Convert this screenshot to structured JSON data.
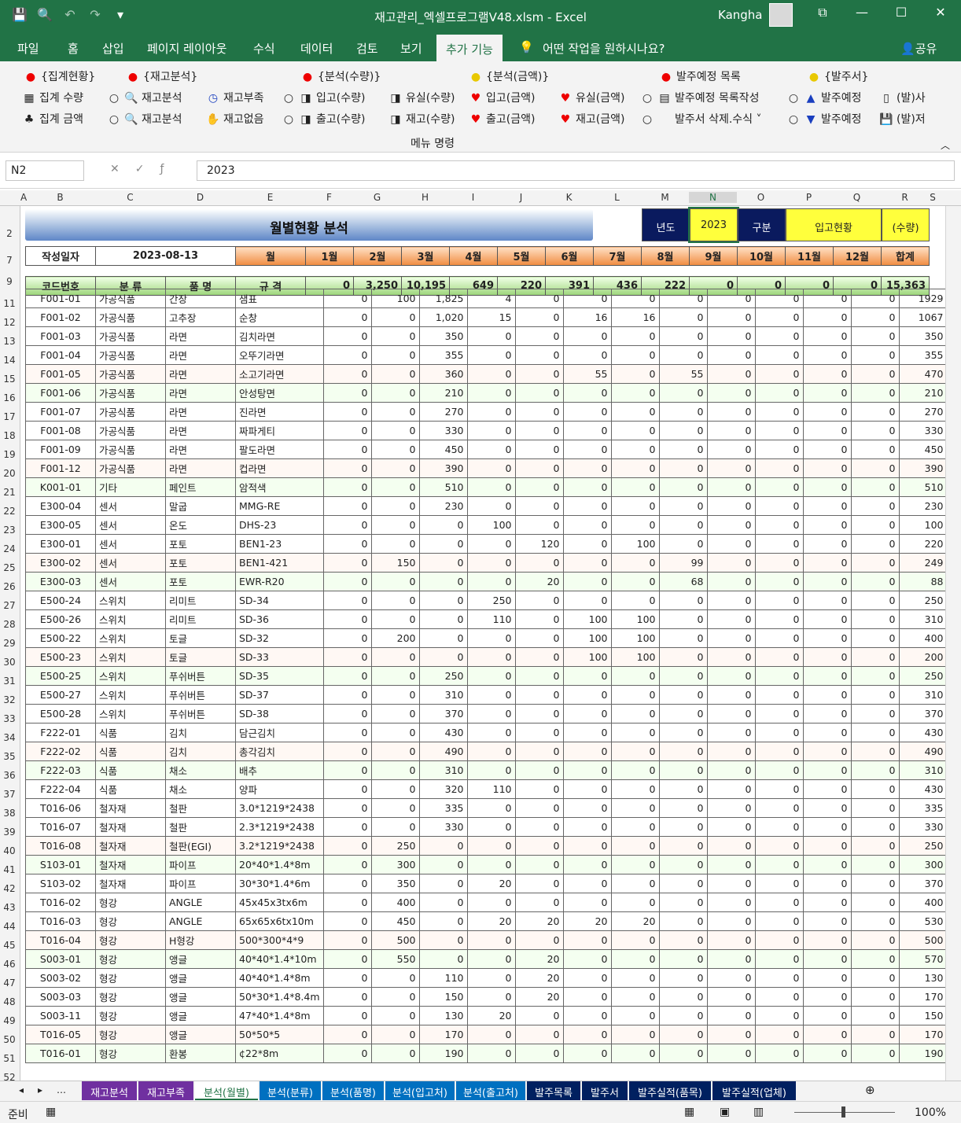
{
  "app": {
    "title": "재고관리_엑셀프로그램V48.xlsm  -  Excel",
    "user": "Kangha"
  },
  "tabs": [
    "파일",
    "홈",
    "삽입",
    "페이지 레이아웃",
    "수식",
    "데이터",
    "검토",
    "보기",
    "추가 기능",
    "어떤 작업을 원하시나요?",
    "공유"
  ],
  "ribbon": {
    "headers": [
      "{집계현황}",
      "{재고분석}",
      "{분석(수량)}",
      "{분석(금액)}",
      "발주예정 목록",
      "{발주서}"
    ],
    "row1": [
      "집계 수량",
      "재고분석",
      "재고부족",
      "입고(수량)",
      "유실(수량)",
      "입고(금액)",
      "유실(금액)",
      "발주예정 목록작성",
      "발주예정",
      "(발)사"
    ],
    "row2": [
      "집계 금액",
      "재고분석",
      "재고없음",
      "출고(수량)",
      "재고(수량)",
      "출고(금액)",
      "재고(금액)",
      "발주서 삭제.수식",
      "발주예정",
      "(발)저"
    ],
    "group": "메뉴 명령"
  },
  "formula": {
    "namebox": "N2",
    "value": "2023"
  },
  "columns": [
    "A",
    "B",
    "C",
    "D",
    "E",
    "F",
    "G",
    "H",
    "I",
    "J",
    "K",
    "L",
    "M",
    "N",
    "O",
    "P",
    "Q",
    "R",
    "S"
  ],
  "rows": [
    "2",
    "7",
    "9",
    "11",
    "12",
    "13",
    "14",
    "15",
    "16",
    "17",
    "18",
    "19",
    "20",
    "21",
    "22",
    "23",
    "24",
    "25",
    "26",
    "27",
    "28",
    "29",
    "30",
    "31",
    "32",
    "33",
    "34",
    "35",
    "36",
    "37",
    "38",
    "39",
    "40",
    "41",
    "42",
    "43",
    "44",
    "45",
    "46",
    "47",
    "48",
    "49",
    "50",
    "51",
    "52"
  ],
  "sheet": {
    "title": "월별현황 분석",
    "year_label": "년도",
    "year": "2023",
    "kind_label": "구분",
    "kind": "입고현황",
    "unit": "(수량)",
    "date_label": "작성일자",
    "date": "2023-08-13",
    "month_header": [
      "월",
      "1월",
      "2월",
      "3월",
      "4월",
      "5월",
      "6월",
      "7월",
      "8월",
      "9월",
      "10월",
      "11월",
      "12월",
      "합계"
    ],
    "col_header": [
      "코드번호",
      "분 류",
      "품 명",
      "규 격"
    ],
    "totals": [
      "0",
      "3,250",
      "10,195",
      "649",
      "220",
      "391",
      "436",
      "222",
      "0",
      "0",
      "0",
      "0",
      "15,363"
    ],
    "data": [
      [
        "F001-01",
        "가공식품",
        "간장",
        "샘표",
        "0",
        "100",
        "1,825",
        "4",
        "0",
        "0",
        "0",
        "0",
        "0",
        "0",
        "0",
        "0",
        "1929"
      ],
      [
        "F001-02",
        "가공식품",
        "고추장",
        "순창",
        "0",
        "0",
        "1,020",
        "15",
        "0",
        "16",
        "16",
        "0",
        "0",
        "0",
        "0",
        "0",
        "1067"
      ],
      [
        "F001-03",
        "가공식품",
        "라면",
        "김치라면",
        "0",
        "0",
        "350",
        "0",
        "0",
        "0",
        "0",
        "0",
        "0",
        "0",
        "0",
        "0",
        "350"
      ],
      [
        "F001-04",
        "가공식품",
        "라면",
        "오뚜기라면",
        "0",
        "0",
        "355",
        "0",
        "0",
        "0",
        "0",
        "0",
        "0",
        "0",
        "0",
        "0",
        "355"
      ],
      [
        "F001-05",
        "가공식품",
        "라면",
        "소고기라면",
        "0",
        "0",
        "360",
        "0",
        "0",
        "55",
        "0",
        "55",
        "0",
        "0",
        "0",
        "0",
        "470"
      ],
      [
        "F001-06",
        "가공식품",
        "라면",
        "안성탕면",
        "0",
        "0",
        "210",
        "0",
        "0",
        "0",
        "0",
        "0",
        "0",
        "0",
        "0",
        "0",
        "210"
      ],
      [
        "F001-07",
        "가공식품",
        "라면",
        "진라면",
        "0",
        "0",
        "270",
        "0",
        "0",
        "0",
        "0",
        "0",
        "0",
        "0",
        "0",
        "0",
        "270"
      ],
      [
        "F001-08",
        "가공식품",
        "라면",
        "짜파게티",
        "0",
        "0",
        "330",
        "0",
        "0",
        "0",
        "0",
        "0",
        "0",
        "0",
        "0",
        "0",
        "330"
      ],
      [
        "F001-09",
        "가공식품",
        "라면",
        "팔도라면",
        "0",
        "0",
        "450",
        "0",
        "0",
        "0",
        "0",
        "0",
        "0",
        "0",
        "0",
        "0",
        "450"
      ],
      [
        "F001-12",
        "가공식품",
        "라면",
        "컵라면",
        "0",
        "0",
        "390",
        "0",
        "0",
        "0",
        "0",
        "0",
        "0",
        "0",
        "0",
        "0",
        "390"
      ],
      [
        "K001-01",
        "기타",
        "페인트",
        "암적색",
        "0",
        "0",
        "510",
        "0",
        "0",
        "0",
        "0",
        "0",
        "0",
        "0",
        "0",
        "0",
        "510"
      ],
      [
        "E300-04",
        "센서",
        "말굽",
        "MMG-RE",
        "0",
        "0",
        "230",
        "0",
        "0",
        "0",
        "0",
        "0",
        "0",
        "0",
        "0",
        "0",
        "230"
      ],
      [
        "E300-05",
        "센서",
        "온도",
        "DHS-23",
        "0",
        "0",
        "0",
        "100",
        "0",
        "0",
        "0",
        "0",
        "0",
        "0",
        "0",
        "0",
        "100"
      ],
      [
        "E300-01",
        "센서",
        "포토",
        "BEN1-23",
        "0",
        "0",
        "0",
        "0",
        "120",
        "0",
        "100",
        "0",
        "0",
        "0",
        "0",
        "0",
        "220"
      ],
      [
        "E300-02",
        "센서",
        "포토",
        "BEN1-421",
        "0",
        "150",
        "0",
        "0",
        "0",
        "0",
        "0",
        "99",
        "0",
        "0",
        "0",
        "0",
        "249"
      ],
      [
        "E300-03",
        "센서",
        "포토",
        "EWR-R20",
        "0",
        "0",
        "0",
        "0",
        "20",
        "0",
        "0",
        "68",
        "0",
        "0",
        "0",
        "0",
        "88"
      ],
      [
        "E500-24",
        "스위치",
        "리미트",
        "SD-34",
        "0",
        "0",
        "0",
        "250",
        "0",
        "0",
        "0",
        "0",
        "0",
        "0",
        "0",
        "0",
        "250"
      ],
      [
        "E500-26",
        "스위치",
        "리미트",
        "SD-36",
        "0",
        "0",
        "0",
        "110",
        "0",
        "100",
        "100",
        "0",
        "0",
        "0",
        "0",
        "0",
        "310"
      ],
      [
        "E500-22",
        "스위치",
        "토글",
        "SD-32",
        "0",
        "200",
        "0",
        "0",
        "0",
        "100",
        "100",
        "0",
        "0",
        "0",
        "0",
        "0",
        "400"
      ],
      [
        "E500-23",
        "스위치",
        "토글",
        "SD-33",
        "0",
        "0",
        "0",
        "0",
        "0",
        "100",
        "100",
        "0",
        "0",
        "0",
        "0",
        "0",
        "200"
      ],
      [
        "E500-25",
        "스위치",
        "푸쉬버튼",
        "SD-35",
        "0",
        "0",
        "250",
        "0",
        "0",
        "0",
        "0",
        "0",
        "0",
        "0",
        "0",
        "0",
        "250"
      ],
      [
        "E500-27",
        "스위치",
        "푸쉬버튼",
        "SD-37",
        "0",
        "0",
        "310",
        "0",
        "0",
        "0",
        "0",
        "0",
        "0",
        "0",
        "0",
        "0",
        "310"
      ],
      [
        "E500-28",
        "스위치",
        "푸쉬버튼",
        "SD-38",
        "0",
        "0",
        "370",
        "0",
        "0",
        "0",
        "0",
        "0",
        "0",
        "0",
        "0",
        "0",
        "370"
      ],
      [
        "F222-01",
        "식품",
        "김치",
        "담근김치",
        "0",
        "0",
        "430",
        "0",
        "0",
        "0",
        "0",
        "0",
        "0",
        "0",
        "0",
        "0",
        "430"
      ],
      [
        "F222-02",
        "식품",
        "김치",
        "총각김치",
        "0",
        "0",
        "490",
        "0",
        "0",
        "0",
        "0",
        "0",
        "0",
        "0",
        "0",
        "0",
        "490"
      ],
      [
        "F222-03",
        "식품",
        "채소",
        "배추",
        "0",
        "0",
        "310",
        "0",
        "0",
        "0",
        "0",
        "0",
        "0",
        "0",
        "0",
        "0",
        "310"
      ],
      [
        "F222-04",
        "식품",
        "채소",
        "양파",
        "0",
        "0",
        "320",
        "110",
        "0",
        "0",
        "0",
        "0",
        "0",
        "0",
        "0",
        "0",
        "430"
      ],
      [
        "T016-06",
        "철자재",
        "철판",
        "3.0*1219*2438",
        "0",
        "0",
        "335",
        "0",
        "0",
        "0",
        "0",
        "0",
        "0",
        "0",
        "0",
        "0",
        "335"
      ],
      [
        "T016-07",
        "철자재",
        "철판",
        "2.3*1219*2438",
        "0",
        "0",
        "330",
        "0",
        "0",
        "0",
        "0",
        "0",
        "0",
        "0",
        "0",
        "0",
        "330"
      ],
      [
        "T016-08",
        "철자재",
        "철판(EGI)",
        "3.2*1219*2438",
        "0",
        "250",
        "0",
        "0",
        "0",
        "0",
        "0",
        "0",
        "0",
        "0",
        "0",
        "0",
        "250"
      ],
      [
        "S103-01",
        "철자재",
        "파이프",
        "20*40*1.4*8m",
        "0",
        "300",
        "0",
        "0",
        "0",
        "0",
        "0",
        "0",
        "0",
        "0",
        "0",
        "0",
        "300"
      ],
      [
        "S103-02",
        "철자재",
        "파이프",
        "30*30*1.4*6m",
        "0",
        "350",
        "0",
        "20",
        "0",
        "0",
        "0",
        "0",
        "0",
        "0",
        "0",
        "0",
        "370"
      ],
      [
        "T016-02",
        "형강",
        "ANGLE",
        "45x45x3tx6m",
        "0",
        "400",
        "0",
        "0",
        "0",
        "0",
        "0",
        "0",
        "0",
        "0",
        "0",
        "0",
        "400"
      ],
      [
        "T016-03",
        "형강",
        "ANGLE",
        "65x65x6tx10m",
        "0",
        "450",
        "0",
        "20",
        "20",
        "20",
        "20",
        "0",
        "0",
        "0",
        "0",
        "0",
        "530"
      ],
      [
        "T016-04",
        "형강",
        "H형강",
        "500*300*4*9",
        "0",
        "500",
        "0",
        "0",
        "0",
        "0",
        "0",
        "0",
        "0",
        "0",
        "0",
        "0",
        "500"
      ],
      [
        "S003-01",
        "형강",
        "앵글",
        "40*40*1.4*10m",
        "0",
        "550",
        "0",
        "0",
        "20",
        "0",
        "0",
        "0",
        "0",
        "0",
        "0",
        "0",
        "570"
      ],
      [
        "S003-02",
        "형강",
        "앵글",
        "40*40*1.4*8m",
        "0",
        "0",
        "110",
        "0",
        "20",
        "0",
        "0",
        "0",
        "0",
        "0",
        "0",
        "0",
        "130"
      ],
      [
        "S003-03",
        "형강",
        "앵글",
        "50*30*1.4*8.4m",
        "0",
        "0",
        "150",
        "0",
        "20",
        "0",
        "0",
        "0",
        "0",
        "0",
        "0",
        "0",
        "170"
      ],
      [
        "S003-11",
        "형강",
        "앵글",
        "47*40*1.4*8m",
        "0",
        "0",
        "130",
        "20",
        "0",
        "0",
        "0",
        "0",
        "0",
        "0",
        "0",
        "0",
        "150"
      ],
      [
        "T016-05",
        "형강",
        "앵글",
        "50*50*5",
        "0",
        "0",
        "170",
        "0",
        "0",
        "0",
        "0",
        "0",
        "0",
        "0",
        "0",
        "0",
        "170"
      ],
      [
        "T016-01",
        "형강",
        "환봉",
        "¢22*8m",
        "0",
        "0",
        "190",
        "0",
        "0",
        "0",
        "0",
        "0",
        "0",
        "0",
        "0",
        "0",
        "190"
      ]
    ]
  },
  "sheet_tabs": [
    "재고분석",
    "재고부족",
    "분석(월별)",
    "분석(분류)",
    "분석(품명)",
    "분석(입고처)",
    "분석(출고처)",
    "발주목록",
    "발주서",
    "발주실적(품목)",
    "발주실적(업체)"
  ],
  "status": {
    "ready": "준비",
    "zoom": "100%"
  }
}
